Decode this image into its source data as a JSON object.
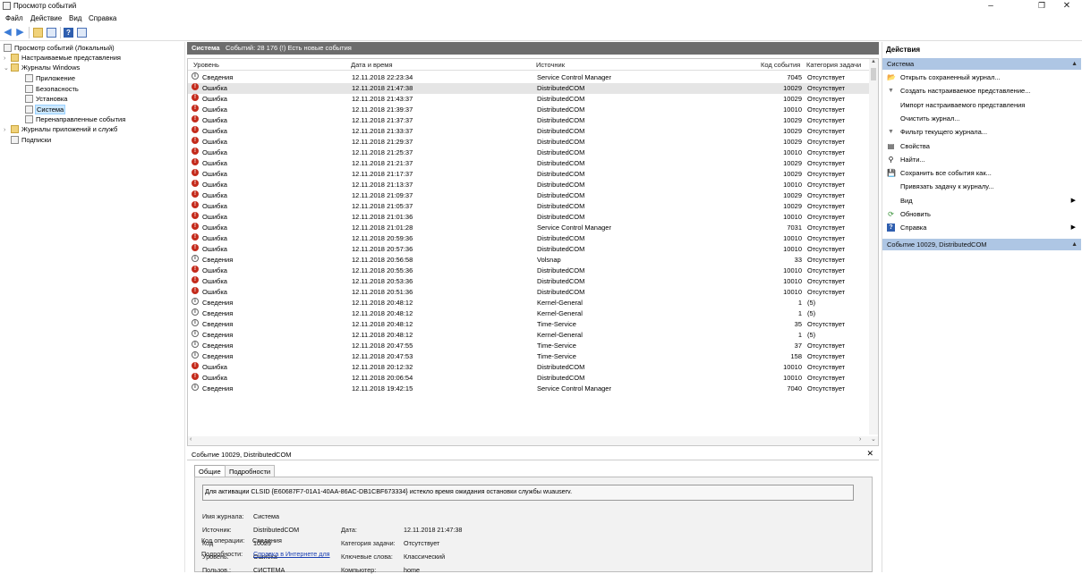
{
  "window": {
    "title": "Просмотр событий"
  },
  "menu": [
    "Файл",
    "Действие",
    "Вид",
    "Справка"
  ],
  "tree": {
    "root": "Просмотр событий (Локальный)",
    "custom_views": "Настраиваемые представления",
    "windows_logs": "Журналы Windows",
    "logs": [
      "Приложение",
      "Безопасность",
      "Установка",
      "Система",
      "Перенаправленные события"
    ],
    "app_services": "Журналы приложений и служб",
    "subscriptions": "Подписки"
  },
  "list": {
    "title": "Система",
    "count": "Событий: 28 176 (!) Есть новые события",
    "columns": [
      "Уровень",
      "Дата и время",
      "Источник",
      "Код события",
      "Категория задачи"
    ],
    "rows": [
      {
        "level": "Сведения",
        "type": "info",
        "date": "12.11.2018 22:23:34",
        "source": "Service Control Manager",
        "code": "7045",
        "cat": "Отсутствует"
      },
      {
        "level": "Ошибка",
        "type": "err",
        "date": "12.11.2018 21:47:38",
        "source": "DistributedCOM",
        "code": "10029",
        "cat": "Отсутствует"
      },
      {
        "level": "Ошибка",
        "type": "err",
        "date": "12.11.2018 21:43:37",
        "source": "DistributedCOM",
        "code": "10029",
        "cat": "Отсутствует"
      },
      {
        "level": "Ошибка",
        "type": "err",
        "date": "12.11.2018 21:39:37",
        "source": "DistributedCOM",
        "code": "10010",
        "cat": "Отсутствует"
      },
      {
        "level": "Ошибка",
        "type": "err",
        "date": "12.11.2018 21:37:37",
        "source": "DistributedCOM",
        "code": "10029",
        "cat": "Отсутствует"
      },
      {
        "level": "Ошибка",
        "type": "err",
        "date": "12.11.2018 21:33:37",
        "source": "DistributedCOM",
        "code": "10029",
        "cat": "Отсутствует"
      },
      {
        "level": "Ошибка",
        "type": "err",
        "date": "12.11.2018 21:29:37",
        "source": "DistributedCOM",
        "code": "10029",
        "cat": "Отсутствует"
      },
      {
        "level": "Ошибка",
        "type": "err",
        "date": "12.11.2018 21:25:37",
        "source": "DistributedCOM",
        "code": "10010",
        "cat": "Отсутствует"
      },
      {
        "level": "Ошибка",
        "type": "err",
        "date": "12.11.2018 21:21:37",
        "source": "DistributedCOM",
        "code": "10029",
        "cat": "Отсутствует"
      },
      {
        "level": "Ошибка",
        "type": "err",
        "date": "12.11.2018 21:17:37",
        "source": "DistributedCOM",
        "code": "10029",
        "cat": "Отсутствует"
      },
      {
        "level": "Ошибка",
        "type": "err",
        "date": "12.11.2018 21:13:37",
        "source": "DistributedCOM",
        "code": "10010",
        "cat": "Отсутствует"
      },
      {
        "level": "Ошибка",
        "type": "err",
        "date": "12.11.2018 21:09:37",
        "source": "DistributedCOM",
        "code": "10029",
        "cat": "Отсутствует"
      },
      {
        "level": "Ошибка",
        "type": "err",
        "date": "12.11.2018 21:05:37",
        "source": "DistributedCOM",
        "code": "10029",
        "cat": "Отсутствует"
      },
      {
        "level": "Ошибка",
        "type": "err",
        "date": "12.11.2018 21:01:36",
        "source": "DistributedCOM",
        "code": "10010",
        "cat": "Отсутствует"
      },
      {
        "level": "Ошибка",
        "type": "err",
        "date": "12.11.2018 21:01:28",
        "source": "Service Control Manager",
        "code": "7031",
        "cat": "Отсутствует"
      },
      {
        "level": "Ошибка",
        "type": "err",
        "date": "12.11.2018 20:59:36",
        "source": "DistributedCOM",
        "code": "10010",
        "cat": "Отсутствует"
      },
      {
        "level": "Ошибка",
        "type": "err",
        "date": "12.11.2018 20:57:36",
        "source": "DistributedCOM",
        "code": "10010",
        "cat": "Отсутствует"
      },
      {
        "level": "Сведения",
        "type": "info",
        "date": "12.11.2018 20:56:58",
        "source": "Volsnap",
        "code": "33",
        "cat": "Отсутствует"
      },
      {
        "level": "Ошибка",
        "type": "err",
        "date": "12.11.2018 20:55:36",
        "source": "DistributedCOM",
        "code": "10010",
        "cat": "Отсутствует"
      },
      {
        "level": "Ошибка",
        "type": "err",
        "date": "12.11.2018 20:53:36",
        "source": "DistributedCOM",
        "code": "10010",
        "cat": "Отсутствует"
      },
      {
        "level": "Ошибка",
        "type": "err",
        "date": "12.11.2018 20:51:36",
        "source": "DistributedCOM",
        "code": "10010",
        "cat": "Отсутствует"
      },
      {
        "level": "Сведения",
        "type": "info",
        "date": "12.11.2018 20:48:12",
        "source": "Kernel-General",
        "code": "1",
        "cat": "(5)"
      },
      {
        "level": "Сведения",
        "type": "info",
        "date": "12.11.2018 20:48:12",
        "source": "Kernel-General",
        "code": "1",
        "cat": "(5)"
      },
      {
        "level": "Сведения",
        "type": "info",
        "date": "12.11.2018 20:48:12",
        "source": "Time-Service",
        "code": "35",
        "cat": "Отсутствует"
      },
      {
        "level": "Сведения",
        "type": "info",
        "date": "12.11.2018 20:48:12",
        "source": "Kernel-General",
        "code": "1",
        "cat": "(5)"
      },
      {
        "level": "Сведения",
        "type": "info",
        "date": "12.11.2018 20:47:55",
        "source": "Time-Service",
        "code": "37",
        "cat": "Отсутствует"
      },
      {
        "level": "Сведения",
        "type": "info",
        "date": "12.11.2018 20:47:53",
        "source": "Time-Service",
        "code": "158",
        "cat": "Отсутствует"
      },
      {
        "level": "Ошибка",
        "type": "err",
        "date": "12.11.2018 20:12:32",
        "source": "DistributedCOM",
        "code": "10010",
        "cat": "Отсутствует"
      },
      {
        "level": "Ошибка",
        "type": "err",
        "date": "12.11.2018 20:06:54",
        "source": "DistributedCOM",
        "code": "10010",
        "cat": "Отсутствует"
      },
      {
        "level": "Сведения",
        "type": "info",
        "date": "12.11.2018 19:42:15",
        "source": "Service Control Manager",
        "code": "7040",
        "cat": "Отсутствует"
      }
    ]
  },
  "detail": {
    "title": "Событие 10029, DistributedCOM",
    "tabs": [
      "Общие",
      "Подробности"
    ],
    "message": "Для активации CLSID {E60687F7-01A1-40AA-86AC-DB1CBF673334} истекло время ожидания остановки службы wuauserv.",
    "labels": {
      "log": "Имя журнала:",
      "source": "Источник:",
      "code": "Код",
      "level": "Уровень:",
      "user": "Пользов.:",
      "opcode": "Код операции:",
      "more": "Подробности:",
      "date": "Дата:",
      "task": "Категория задачи:",
      "keywords": "Ключевые слова:",
      "computer": "Компьютер:"
    },
    "values": {
      "log": "Система",
      "source": "DistributedCOM",
      "code": "10029",
      "level": "Ошибка",
      "user": "СИСТЕМА",
      "opcode": "Сведения",
      "more": "Справка в Интернете для",
      "date": "12.11.2018 21:47:38",
      "task": "Отсутствует",
      "keywords": "Классический",
      "computer": "home"
    }
  },
  "actions": {
    "title": "Действия",
    "section1": "Система",
    "items": [
      {
        "label": "Открыть сохраненный журнал...",
        "icon": "folder-open-icon",
        "glyph": "📂"
      },
      {
        "label": "Создать настраиваемое представление...",
        "icon": "filter-icon",
        "glyph": "▼"
      },
      {
        "label": "Импорт настраиваемого представления",
        "icon": "",
        "glyph": ""
      },
      {
        "label": "Очистить журнал...",
        "icon": "",
        "glyph": ""
      },
      {
        "label": "Фильтр текущего журнала...",
        "icon": "filter-icon",
        "glyph": "▼"
      },
      {
        "label": "Свойства",
        "icon": "properties-icon",
        "glyph": "▤"
      },
      {
        "label": "Найти...",
        "icon": "find-icon",
        "glyph": "⚲"
      },
      {
        "label": "Сохранить все события как...",
        "icon": "save-icon",
        "glyph": "💾"
      },
      {
        "label": "Привязать задачу к журналу...",
        "icon": "",
        "glyph": ""
      },
      {
        "label": "Вид",
        "icon": "",
        "glyph": "",
        "sub": true
      },
      {
        "label": "Обновить",
        "icon": "refresh-icon",
        "glyph": "⟳"
      },
      {
        "label": "Справка",
        "icon": "help-icon",
        "glyph": "?",
        "sub": true
      }
    ],
    "section2": "Событие 10029, DistributedCOM"
  }
}
